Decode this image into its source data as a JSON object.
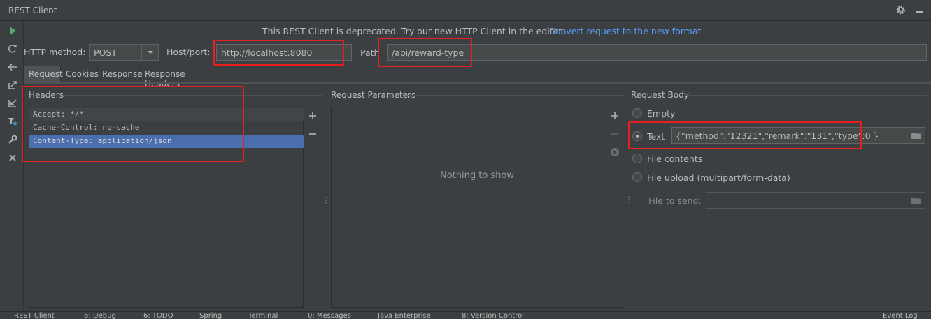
{
  "window": {
    "title": "REST Client"
  },
  "banner": {
    "text": "This REST Client is deprecated. Try our new HTTP Client in the editor.",
    "link": "Convert request to the new format"
  },
  "request": {
    "method_label": "HTTP method:",
    "method_value": "POST",
    "host_label": "Host/port:",
    "host_value": "http://localhost:8080",
    "path_label": "Path",
    "path_value": "/api/reward-type"
  },
  "tabs": [
    "Request",
    "Cookies",
    "Response",
    "Response Headers"
  ],
  "headers": {
    "title": "Headers",
    "rows": [
      "Accept: */*",
      "Cache-Control: no-cache",
      "Content-Type: application/json"
    ]
  },
  "params": {
    "title": "Request Parameters",
    "empty_text": "Nothing to show"
  },
  "body": {
    "title": "Request Body",
    "options": [
      "Empty",
      "Text",
      "File contents",
      "File upload (multipart/form-data)"
    ],
    "selected": "Text",
    "text_value": "{\"method\":\"12321\",\"remark\":\"131\",\"type\":0 }",
    "file_label": "File to send:",
    "file_value": ""
  },
  "statusbar": {
    "items": [
      "REST Client",
      "6: Debug",
      "6: TODO",
      "Spring",
      "Terminal",
      "0: Messages",
      "Java Enterprise",
      "8: Version Control",
      "Event Log"
    ]
  },
  "colors": {
    "accent": "#4b6eaf",
    "link": "#589df6",
    "highlight_box": "#e8201d",
    "run": "#59a869"
  }
}
